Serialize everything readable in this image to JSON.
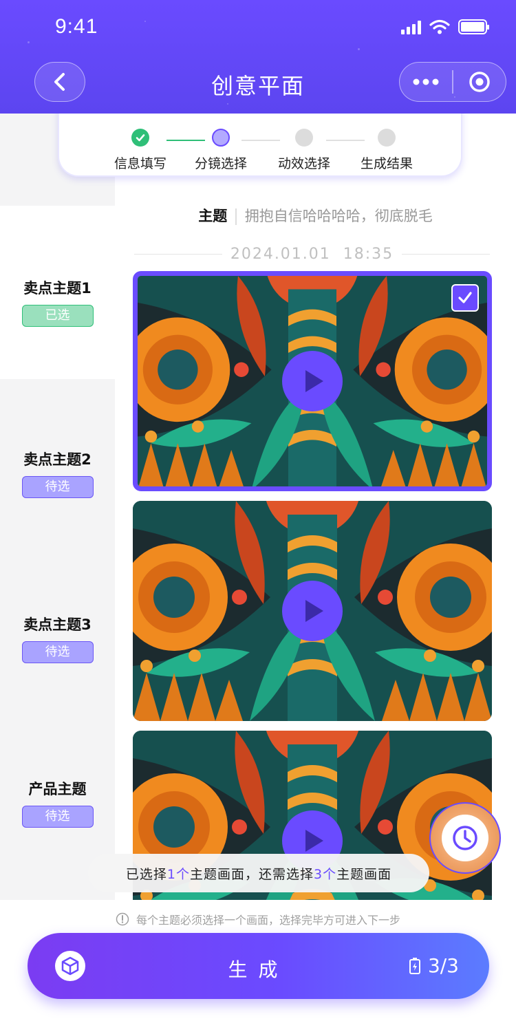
{
  "status_bar": {
    "time": "9:41"
  },
  "header": {
    "title": "创意平面",
    "back_icon": "chevron-left-icon",
    "more_icon": "more-dots-icon",
    "close_icon": "target-circle-icon"
  },
  "steps": [
    {
      "label": "信息填写",
      "state": "done"
    },
    {
      "label": "分镜选择",
      "state": "current"
    },
    {
      "label": "动效选择",
      "state": "todo"
    },
    {
      "label": "生成结果",
      "state": "todo"
    }
  ],
  "sidebar": {
    "items": [
      {
        "name": "卖点主题1",
        "tag": "已选",
        "state": "selected"
      },
      {
        "name": "卖点主题2",
        "tag": "待选",
        "state": "pending"
      },
      {
        "name": "卖点主题3",
        "tag": "待选",
        "state": "pending"
      },
      {
        "name": "产品主题",
        "tag": "待选",
        "state": "pending"
      }
    ]
  },
  "main": {
    "theme_key": "主题",
    "theme_value": "拥抱自信哈哈哈哈，彻底脱毛",
    "datetime": "2024.01.01  18:35",
    "cards": [
      {
        "checked": true
      },
      {
        "checked": false
      },
      {
        "checked": false
      }
    ]
  },
  "toast": {
    "part1": "已选择",
    "count1": "1个",
    "part2": "主题画面，还需选择",
    "count2": "3个",
    "part3": "主题画面"
  },
  "bottom": {
    "notice": "每个主题必须选择一个画面，选择完毕方可进入下一步",
    "generate_label": "生成",
    "quota": "3/3"
  },
  "colors": {
    "accent": "#6a4bff",
    "success": "#2fbf78"
  }
}
